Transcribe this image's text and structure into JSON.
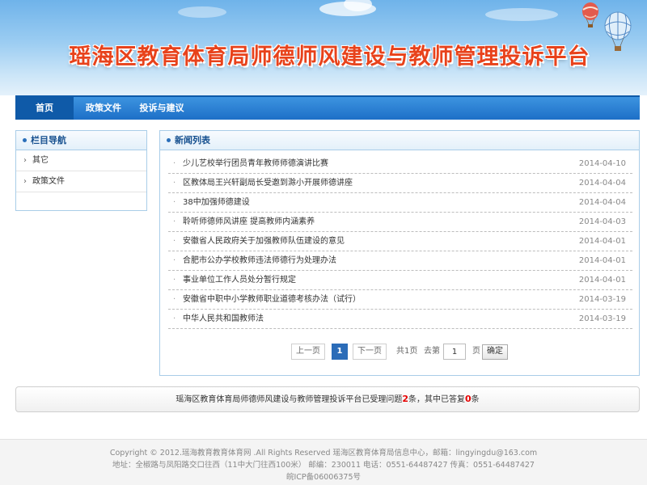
{
  "header": {
    "site_title": "瑶海区教育体育局师德师风建设与教师管理投诉平台"
  },
  "nav": {
    "items": [
      {
        "label": "首页",
        "active": true
      },
      {
        "label": "政策文件",
        "active": false
      },
      {
        "label": "投诉与建议",
        "active": false
      }
    ]
  },
  "sidebar": {
    "title": "栏目导航",
    "items": [
      {
        "label": "其它"
      },
      {
        "label": "政策文件"
      }
    ]
  },
  "news": {
    "title": "新闻列表",
    "items": [
      {
        "title": "少儿艺校举行团员青年教师师德演讲比赛",
        "date": "2014-04-10"
      },
      {
        "title": "区教体局王兴轩副局长受邀到滁小开展师德讲座",
        "date": "2014-04-04"
      },
      {
        "title": "38中加强师德建设",
        "date": "2014-04-04"
      },
      {
        "title": "聆听师德师风讲座 提高教师内涵素养",
        "date": "2014-04-03"
      },
      {
        "title": "安徽省人民政府关于加强教师队伍建设的意见",
        "date": "2014-04-01"
      },
      {
        "title": "合肥市公办学校教师违法师德行为处理办法",
        "date": "2014-04-01"
      },
      {
        "title": "事业单位工作人员处分暂行规定",
        "date": "2014-04-01"
      },
      {
        "title": "安徽省中职中小学教师职业道德考核办法（试行）",
        "date": "2014-03-19"
      },
      {
        "title": "中华人民共和国教师法",
        "date": "2014-03-19"
      }
    ]
  },
  "pager": {
    "prev_label": "上一页",
    "current_page": "1",
    "next_label": "下一页",
    "total_text": "共1页",
    "goto_label": "去第",
    "goto_value": "1",
    "page_unit": "页",
    "confirm_label": "确定"
  },
  "status": {
    "prefix": "瑶海区教育体育局师德师风建设与教师管理投诉平台已受理问题",
    "accepted_count": "2",
    "middle": "条，其中已答复",
    "answered_count": "0",
    "suffix": "条"
  },
  "footer": {
    "line1": "Copyright © 2012.瑶海教育教育体育网 .All Rights Reserved 瑶海区教育体育局信息中心，邮箱：lingyingdu@163.com",
    "line2": "地址：全椒路与凤阳路交口往西（11中大门往西100米） 邮编：230011 电话：0551-64487427 传真：0551-64487427",
    "line3": "皖ICP备06006375号"
  },
  "colors": {
    "title_red": "#e8421b",
    "nav_blue": "#1d6fc7",
    "nav_active": "#0f5aa8",
    "panel_border": "#a9cde8",
    "count_red": "#e60000"
  }
}
